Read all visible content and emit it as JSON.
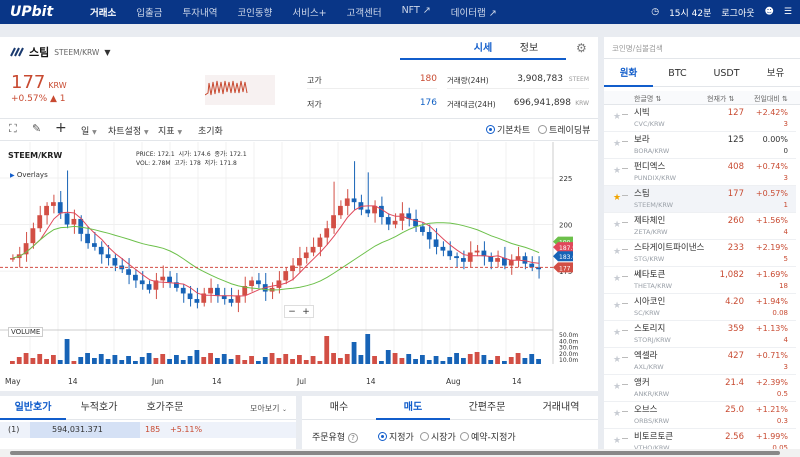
{
  "header": {
    "logo": "UPbit",
    "nav": [
      "거래소",
      "입출금",
      "투자내역",
      "코인동향",
      "서비스+",
      "고객센터",
      "NFT ↗",
      "데이터랩 ↗"
    ],
    "clock": "15시 42분",
    "logout": "로그아웃"
  },
  "coin": {
    "name": "스팀",
    "pair": "STEEM/KRW",
    "price": "177",
    "unit": "KRW",
    "change_pct": "+0.57%",
    "change_abs": "▲ 1",
    "tabs": [
      "시세",
      "정보"
    ],
    "high_label": "고가",
    "high": "180",
    "low_label": "저가",
    "low": "176",
    "vol_label": "거래량(24H)",
    "vol": "3,908,783",
    "vol_unit": "STEEM",
    "amt_label": "거래대금(24H)",
    "amt": "696,941,898",
    "amt_unit": "KRW"
  },
  "toolbar": {
    "interval": "일",
    "chart_settings": "차트설정",
    "indicators": "지표",
    "reset": "초기화",
    "basic_chart": "기본차트",
    "tradingview": "트레이딩뷰"
  },
  "chart_info": {
    "symbol": "STEEM/KRW",
    "overlays": "Overlays",
    "price_label": "PRICE:",
    "price_val": "172.1",
    "open_label": "시가:",
    "open_val": "174.6",
    "close_label": "종가:",
    "close_val": "172.1",
    "vol_label": "VOL:",
    "vol_val": "2.78M",
    "high_label": "고가:",
    "high_val": "178",
    "low_label": "저가:",
    "low_val": "171.8",
    "volume_title": "VOLUME",
    "current_tag": "177",
    "ma_tag1": "190.8",
    "ma_tag2": "187.9",
    "ma_tag3": "183.0"
  },
  "chart_data": {
    "type": "candlestick",
    "price_axis_ticks": [
      175,
      200,
      225
    ],
    "volume_axis_ticks": [
      "50.0m",
      "40.0m",
      "30.0m",
      "20.0m",
      "10.0m"
    ],
    "x_labels": [
      "May",
      "14",
      "Jun",
      "14",
      "Jul",
      "14",
      "Aug",
      "14"
    ],
    "current_price": 177
  },
  "orderbook": {
    "tabs": [
      "일반호가",
      "누적호가",
      "호가주문"
    ],
    "view": "모아보기",
    "row": {
      "idx": "(1)",
      "qty": "594,031.371",
      "price": "185",
      "pct": "+5.11%"
    }
  },
  "order": {
    "tabs": [
      "매수",
      "매도",
      "간편주문",
      "거래내역"
    ],
    "type_label": "주문유형",
    "types": [
      "지정가",
      "시장가",
      "예약-지정가"
    ]
  },
  "market": {
    "search_placeholder": "코인명/심볼검색",
    "tabs": [
      "원화",
      "BTC",
      "USDT",
      "보유"
    ],
    "headers": [
      "한글명",
      "현재가",
      "전일대비"
    ],
    "coins": [
      {
        "name": "시빅",
        "code": "CVC/KRW",
        "price": "127",
        "pct": "+2.42%",
        "abs": "3",
        "dir": "up"
      },
      {
        "name": "보라",
        "code": "BORA/KRW",
        "price": "125",
        "pct": "0.00%",
        "abs": "0",
        "dir": "flat"
      },
      {
        "name": "펀디엑스",
        "code": "PUNDIX/KRW",
        "price": "408",
        "pct": "+0.74%",
        "abs": "3",
        "dir": "up"
      },
      {
        "name": "스팀",
        "code": "STEEM/KRW",
        "price": "177",
        "pct": "+0.57%",
        "abs": "1",
        "dir": "up"
      },
      {
        "name": "제타체인",
        "code": "ZETA/KRW",
        "price": "260",
        "pct": "+1.56%",
        "abs": "4",
        "dir": "up"
      },
      {
        "name": "스타게이트파이낸스",
        "code": "STG/KRW",
        "price": "233",
        "pct": "+2.19%",
        "abs": "5",
        "dir": "up"
      },
      {
        "name": "쎄타토큰",
        "code": "THETA/KRW",
        "price": "1,082",
        "pct": "+1.69%",
        "abs": "18",
        "dir": "up"
      },
      {
        "name": "시아코인",
        "code": "SC/KRW",
        "price": "4.20",
        "pct": "+1.94%",
        "abs": "0.08",
        "dir": "up"
      },
      {
        "name": "스토리지",
        "code": "STORJ/KRW",
        "price": "359",
        "pct": "+1.13%",
        "abs": "4",
        "dir": "up"
      },
      {
        "name": "엑셀라",
        "code": "AXL/KRW",
        "price": "427",
        "pct": "+0.71%",
        "abs": "3",
        "dir": "up"
      },
      {
        "name": "앵커",
        "code": "ANKR/KRW",
        "price": "21.4",
        "pct": "+2.39%",
        "abs": "0.5",
        "dir": "up"
      },
      {
        "name": "오브스",
        "code": "ORBS/KRW",
        "price": "25.0",
        "pct": "+1.21%",
        "abs": "0.3",
        "dir": "up"
      },
      {
        "name": "비토르토큰",
        "code": "VTHO/KRW",
        "price": "2.56",
        "pct": "+1.99%",
        "abs": "0.05",
        "dir": "up"
      }
    ]
  },
  "colors": {
    "brand": "#093687",
    "up": "#c84a31",
    "down": "#1261c4",
    "accent": "#115dcb"
  }
}
